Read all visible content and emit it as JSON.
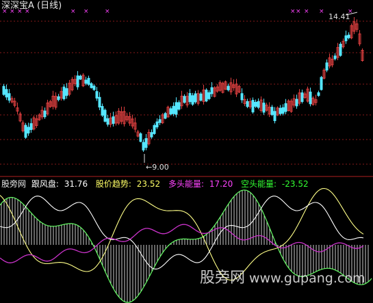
{
  "header": {
    "title": "深深宝A (日线)"
  },
  "signal_marks": {
    "symbol": "×",
    "count": 12,
    "color": "#ff44ff"
  },
  "price_panel": {
    "high_annotation": "14.41",
    "low_annotation": "9.00",
    "bull_candle_color": "#e04040",
    "bear_candle_color": "#55e6ff"
  },
  "indicator": {
    "name": "股旁网",
    "items": [
      {
        "label": "跟风盘:",
        "value": "31.76",
        "color": "#ffffff"
      },
      {
        "label": "股价趋势:",
        "value": "23.52",
        "color": "#ffff66"
      },
      {
        "label": "多头能量:",
        "value": "17.20",
        "color": "#ff44ff"
      },
      {
        "label": "空头能量:",
        "value": "-23.52",
        "color": "#33ff33"
      }
    ]
  },
  "watermark": {
    "text": "股旁网",
    "url": "www.gupang.com"
  },
  "colors": {
    "background": "#000000",
    "grid": "#8a1a1a",
    "separator": "#b02020",
    "hist_line": "#ffffff",
    "energy_outline": "#66ff66",
    "trend_line": "#ffff88",
    "follow_line": "#ffffff",
    "bull_line": "#cc33cc"
  }
}
